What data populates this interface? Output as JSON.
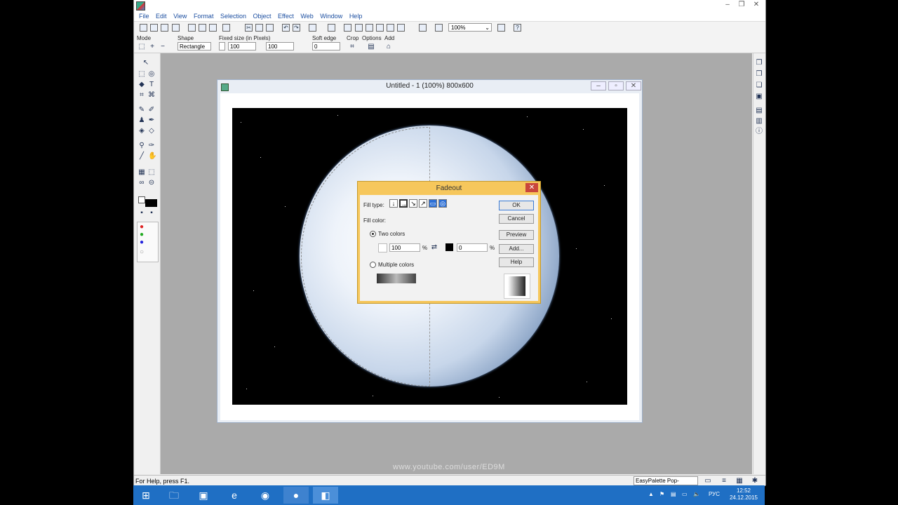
{
  "app": {
    "menus": [
      "File",
      "Edit",
      "View",
      "Format",
      "Selection",
      "Object",
      "Effect",
      "Web",
      "Window",
      "Help"
    ]
  },
  "toolbar": {
    "zoom": "100%"
  },
  "options_bar": {
    "mode_label": "Mode",
    "shape_label": "Shape",
    "shape_value": "Rectangle",
    "fixed_size_label": "Fixed size (in Pixels)",
    "width": "100",
    "height": "100",
    "soft_edge_label": "Soft edge",
    "soft_edge_value": "0",
    "crop_label": "Crop",
    "options_label": "Options",
    "add_label": "Add"
  },
  "document": {
    "title": "Untitled - 1 (100%) 800x600"
  },
  "dialog": {
    "title": "Fadeout",
    "fill_type_label": "Fill type:",
    "fill_color_label": "Fill color:",
    "two_colors_label": "Two colors",
    "multiple_colors_label": "Multiple colors",
    "color1_percent": "100",
    "color2_percent": "0",
    "percent_sign": "%",
    "buttons": {
      "ok": "OK",
      "cancel": "Cancel",
      "preview": "Preview",
      "add": "Add...",
      "help": "Help"
    }
  },
  "status": {
    "help_text": "For Help, press F1.",
    "palette": "EasyPalette Pop-"
  },
  "taskbar": {
    "lang": "РУС",
    "time": "12:52",
    "date": "24.12.2015"
  },
  "watermark": "www.youtube.com/user/ED9M"
}
